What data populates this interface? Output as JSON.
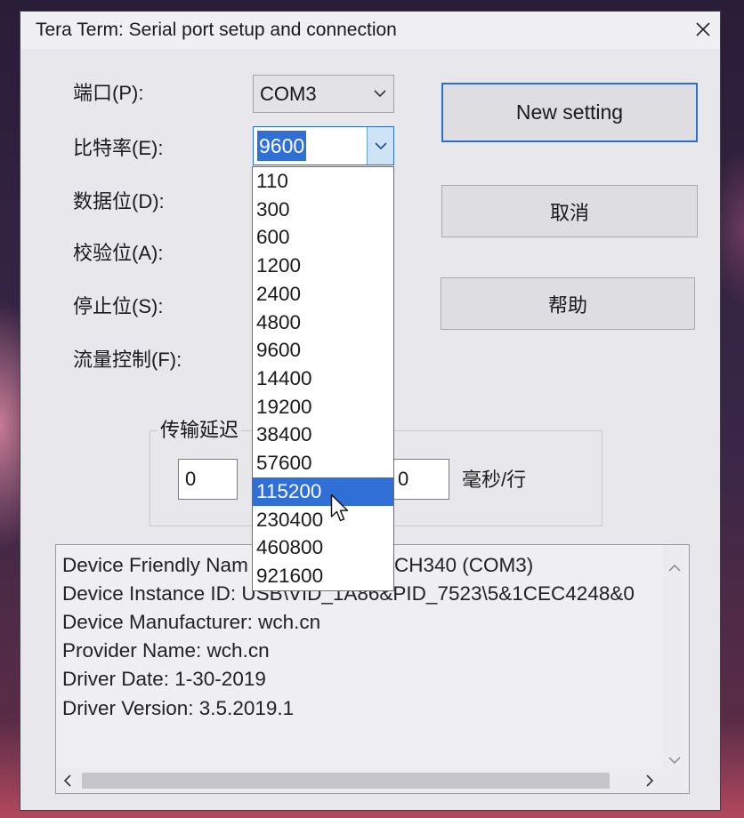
{
  "window": {
    "title": "Tera Term: Serial port setup and connection",
    "close_icon": "close-icon"
  },
  "form": {
    "port": {
      "label": "端口(P):",
      "value": "COM3",
      "icon": "chevron-down-icon"
    },
    "baud": {
      "label": "比特率(E):",
      "value": "9600",
      "icon": "chevron-down-icon",
      "dropdown_open": true,
      "options": [
        "110",
        "300",
        "600",
        "1200",
        "2400",
        "4800",
        "9600",
        "14400",
        "19200",
        "38400",
        "57600",
        "115200",
        "230400",
        "460800",
        "921600"
      ],
      "highlighted_option": "115200"
    },
    "data_bits": {
      "label": "数据位(D):"
    },
    "parity": {
      "label": "校验位(A):"
    },
    "stop_bits": {
      "label": "停止位(S):"
    },
    "flow_control": {
      "label": "流量控制(F):"
    }
  },
  "buttons": {
    "new_setting": "New setting",
    "cancel": "取消",
    "help": "帮助"
  },
  "transmit_delay": {
    "legend": "传输延迟",
    "first_value": "0",
    "second_value": "0",
    "second_unit": "毫秒/行"
  },
  "device_info": {
    "first_line_start": "Device Friendly Nam",
    "first_line_end": "CH340 (COM3)",
    "lines": [
      "Device Instance ID: USB\\VID_1A86&PID_7523\\5&1CEC4248&0",
      "Device Manufacturer: wch.cn",
      "Provider Name: wch.cn",
      "Driver Date: 1-30-2019",
      "Driver Version: 3.5.2019.1"
    ],
    "scroll_icons": [
      "chevron-up-icon",
      "chevron-down-icon",
      "chevron-left-icon",
      "chevron-right-icon"
    ]
  },
  "pointer": {
    "icon": "pointer-cursor-icon"
  },
  "colors": {
    "accent": "#2f6fd6",
    "focus_border": "#2a6fcf",
    "dialog_bg": "#e8e8ec",
    "dropdown_button_bg": "#cfe3f6"
  }
}
